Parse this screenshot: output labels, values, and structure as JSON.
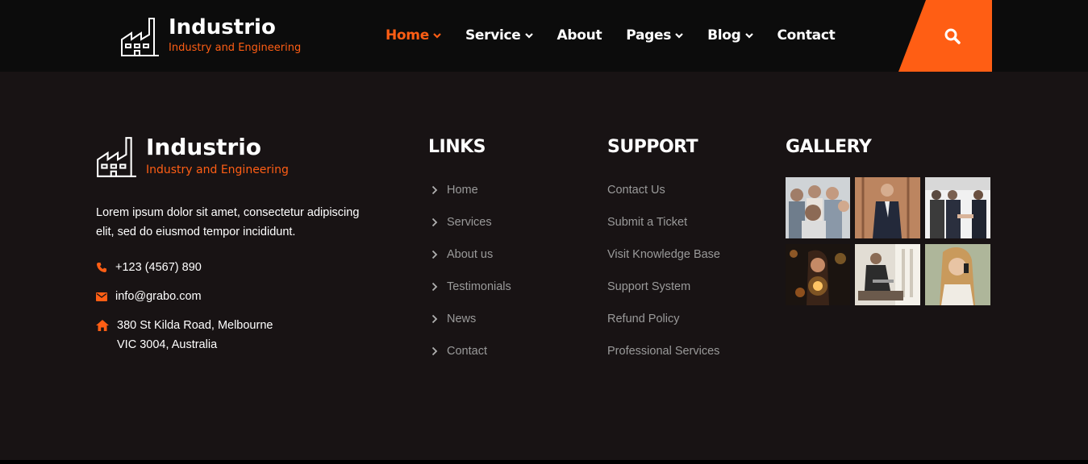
{
  "brand": {
    "name": "Industrio",
    "tagline": "Industry and Engineering",
    "accent_color": "#ff5e14"
  },
  "nav": {
    "items": [
      {
        "label": "Home",
        "dropdown": true,
        "active": true
      },
      {
        "label": "Service",
        "dropdown": true
      },
      {
        "label": "About",
        "dropdown": false
      },
      {
        "label": "Pages",
        "dropdown": true
      },
      {
        "label": "Blog",
        "dropdown": true
      },
      {
        "label": "Contact",
        "dropdown": false
      }
    ],
    "search_icon": "search-icon"
  },
  "footer": {
    "about_text": "Lorem ipsum dolor sit amet, consectetur adipiscing elit, sed do eiusmod tempor incididunt.",
    "phone": "+123 (4567) 890",
    "email": "info@grabo.com",
    "address_line1": "380 St Kilda Road, Melbourne",
    "address_line2": "VIC 3004, Australia",
    "links": {
      "title": "LINKS",
      "items": [
        "Home",
        "Services",
        "About us",
        "Testimonials",
        "News",
        "Contact"
      ]
    },
    "support": {
      "title": "SUPPORT",
      "items": [
        "Contact Us",
        "Submit a Ticket",
        "Visit Knowledge Base",
        "Support System",
        "Refund Policy",
        "Professional Services"
      ]
    },
    "gallery": {
      "title": "GALLERY"
    }
  }
}
